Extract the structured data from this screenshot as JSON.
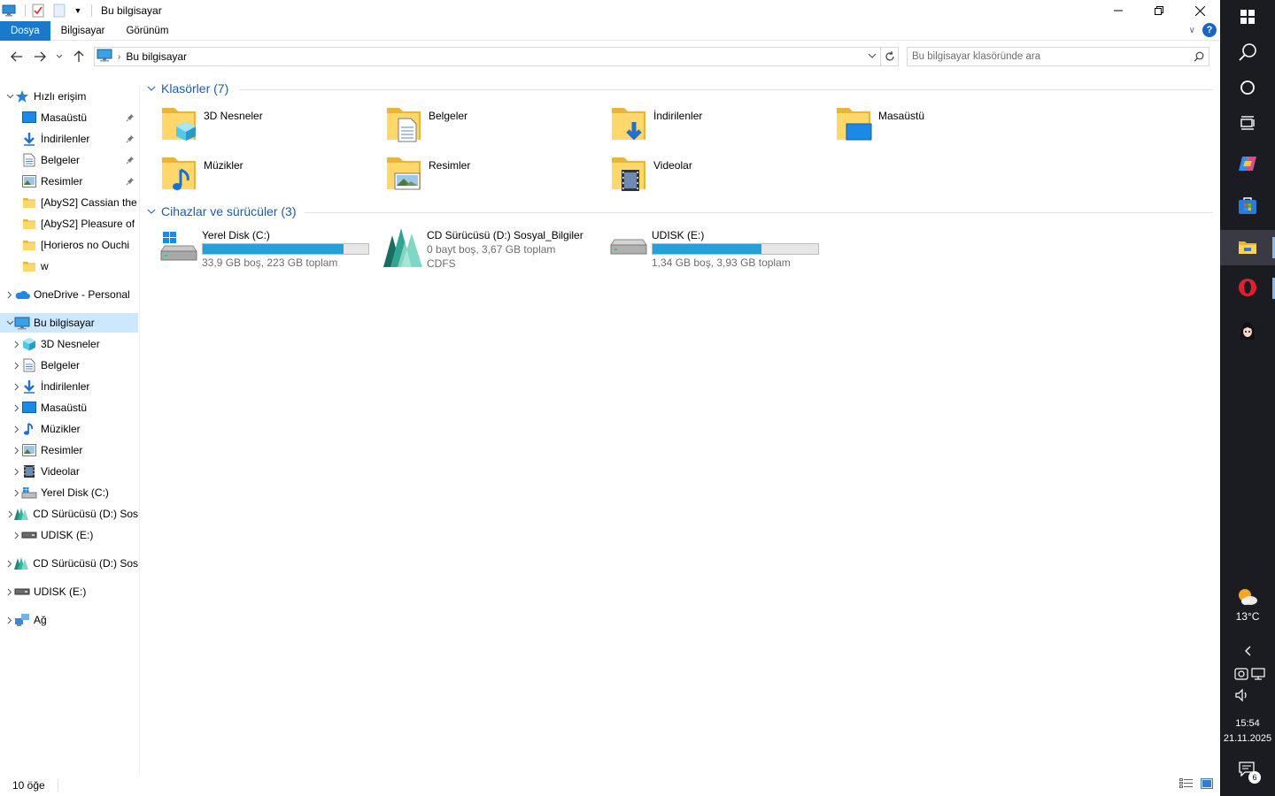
{
  "window": {
    "title": "Bu bilgisayar"
  },
  "ribbon": {
    "tabs": [
      "Dosya",
      "Bilgisayar",
      "Görünüm"
    ]
  },
  "address": {
    "path": "Bu bilgisayar",
    "search_placeholder": "Bu bilgisayar klasöründe ara"
  },
  "navpane": {
    "items": [
      {
        "label": "Hızlı erişim",
        "icon": "star-icon",
        "level": 0,
        "expanded": true
      },
      {
        "label": "Masaüstü",
        "icon": "desktop-icon",
        "level": 1,
        "pinned": true
      },
      {
        "label": "İndirilenler",
        "icon": "download-icon",
        "level": 1,
        "pinned": true
      },
      {
        "label": "Belgeler",
        "icon": "document-icon",
        "level": 1,
        "pinned": true
      },
      {
        "label": "Resimler",
        "icon": "pictures-icon",
        "level": 1,
        "pinned": true
      },
      {
        "label": "[AbyS2] Cassian the",
        "icon": "folder-icon",
        "level": 1
      },
      {
        "label": "[AbyS2] Pleasure of",
        "icon": "folder-icon",
        "level": 1
      },
      {
        "label": "[Horieros no Ouchi",
        "icon": "folder-icon",
        "level": 1
      },
      {
        "label": "w",
        "icon": "folder-icon",
        "level": 1
      },
      {
        "label": "OneDrive - Personal",
        "icon": "onedrive-icon",
        "level": 0,
        "expanded": false
      },
      {
        "label": "Bu bilgisayar",
        "icon": "pc-icon",
        "level": 0,
        "expanded": true,
        "selected": true
      },
      {
        "label": "3D Nesneler",
        "icon": "3d-objects-icon",
        "level": 1
      },
      {
        "label": "Belgeler",
        "icon": "document-icon",
        "level": 1
      },
      {
        "label": "İndirilenler",
        "icon": "download-icon",
        "level": 1
      },
      {
        "label": "Masaüstü",
        "icon": "desktop-icon",
        "level": 1
      },
      {
        "label": "Müzikler",
        "icon": "music-icon",
        "level": 1
      },
      {
        "label": "Resimler",
        "icon": "pictures-icon",
        "level": 1
      },
      {
        "label": "Videolar",
        "icon": "video-icon",
        "level": 1
      },
      {
        "label": "Yerel Disk (C:)",
        "icon": "windows-drive-icon",
        "level": 1
      },
      {
        "label": "CD Sürücüsü (D:) Sos",
        "icon": "cd-drive-icon",
        "level": 1
      },
      {
        "label": "UDISK (E:)",
        "icon": "usb-drive-icon",
        "level": 1
      },
      {
        "label": "CD Sürücüsü (D:) Sos",
        "icon": "cd-drive-icon",
        "level": 0
      },
      {
        "label": "UDISK (E:)",
        "icon": "usb-drive-icon",
        "level": 0
      },
      {
        "label": "Ağ",
        "icon": "network-icon",
        "level": 0
      }
    ]
  },
  "content": {
    "folders_header": "Klasörler (7)",
    "folders": [
      {
        "name": "3D Nesneler",
        "icon": "3d-objects-icon"
      },
      {
        "name": "Belgeler",
        "icon": "document-icon"
      },
      {
        "name": "İndirilenler",
        "icon": "download-icon"
      },
      {
        "name": "Masaüstü",
        "icon": "desktop-icon"
      },
      {
        "name": "Müzikler",
        "icon": "music-icon"
      },
      {
        "name": "Resimler",
        "icon": "pictures-icon"
      },
      {
        "name": "Videolar",
        "icon": "video-icon"
      }
    ],
    "drives_header": "Cihazlar ve sürücüler (3)",
    "drives": [
      {
        "name": "Yerel Disk (C:)",
        "detail": "33,9 GB boş, 223 GB toplam",
        "used_fraction": 0.848,
        "has_bar": true,
        "icon": "windows-drive-icon"
      },
      {
        "name": "CD Sürücüsü (D:) Sosyal_Bilgiler",
        "detail": "0 bayt boş, 3,67 GB toplam",
        "extra": "CDFS",
        "has_bar": false,
        "icon": "cd-drive-icon"
      },
      {
        "name": "UDISK (E:)",
        "detail": "1,34 GB boş, 3,93 GB toplam",
        "used_fraction": 0.659,
        "has_bar": true,
        "icon": "usb-drive-icon"
      }
    ]
  },
  "status": {
    "count": "10 öğe"
  },
  "taskbar": {
    "temperature": "13°C",
    "time": "15:54",
    "date": "21.11.2025",
    "notifications": "6",
    "colors": {
      "background": "#1b1b22",
      "accent": "#1979ca",
      "bar_fill": "#26a0da"
    }
  }
}
